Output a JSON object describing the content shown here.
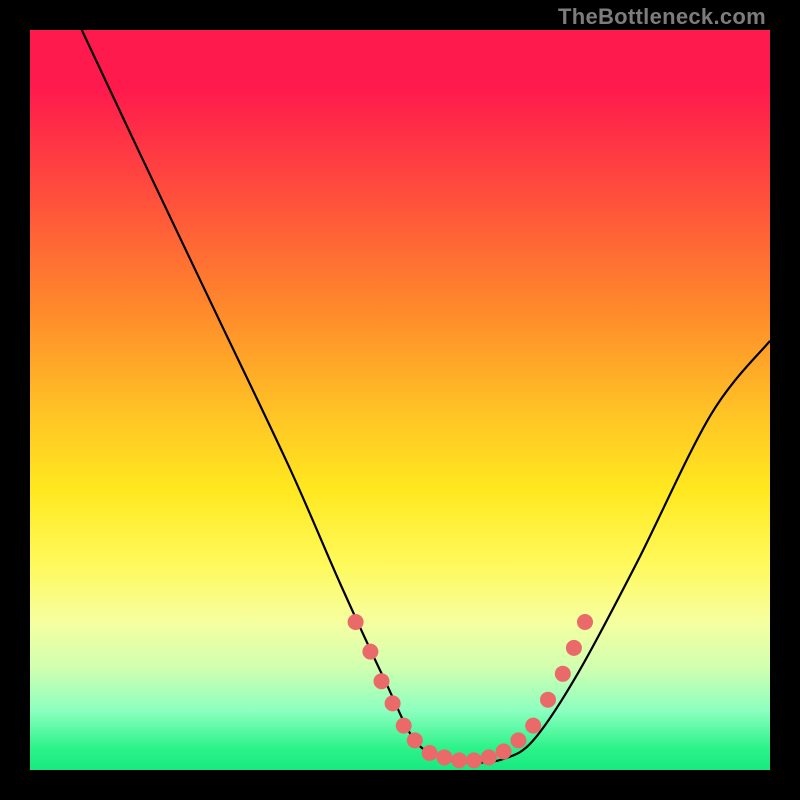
{
  "attribution": "TheBottleneck.com",
  "chart_data": {
    "type": "line",
    "title": "",
    "xlabel": "",
    "ylabel": "",
    "xlim": [
      0,
      100
    ],
    "ylim": [
      0,
      100
    ],
    "grid": false,
    "curve": {
      "name": "bottleneck-curve",
      "color": "#000000",
      "points": [
        {
          "x": 7,
          "y": 100
        },
        {
          "x": 15,
          "y": 83
        },
        {
          "x": 25,
          "y": 62
        },
        {
          "x": 35,
          "y": 41
        },
        {
          "x": 42,
          "y": 25
        },
        {
          "x": 48,
          "y": 12
        },
        {
          "x": 52,
          "y": 4
        },
        {
          "x": 56,
          "y": 1.5
        },
        {
          "x": 60,
          "y": 1
        },
        {
          "x": 64,
          "y": 1.5
        },
        {
          "x": 68,
          "y": 4
        },
        {
          "x": 74,
          "y": 13
        },
        {
          "x": 82,
          "y": 28
        },
        {
          "x": 92,
          "y": 48
        },
        {
          "x": 100,
          "y": 58
        }
      ]
    },
    "markers": {
      "name": "highlight-dots",
      "color": "#ea6a6a",
      "radius_px": 8,
      "points": [
        {
          "x": 44,
          "y": 20
        },
        {
          "x": 46,
          "y": 16
        },
        {
          "x": 47.5,
          "y": 12
        },
        {
          "x": 49,
          "y": 9
        },
        {
          "x": 50.5,
          "y": 6
        },
        {
          "x": 52,
          "y": 4
        },
        {
          "x": 54,
          "y": 2.3
        },
        {
          "x": 56,
          "y": 1.7
        },
        {
          "x": 58,
          "y": 1.3
        },
        {
          "x": 60,
          "y": 1.3
        },
        {
          "x": 62,
          "y": 1.7
        },
        {
          "x": 64,
          "y": 2.5
        },
        {
          "x": 66,
          "y": 4
        },
        {
          "x": 68,
          "y": 6
        },
        {
          "x": 70,
          "y": 9.5
        },
        {
          "x": 72,
          "y": 13
        },
        {
          "x": 73.5,
          "y": 16.5
        },
        {
          "x": 75,
          "y": 20
        }
      ]
    }
  }
}
